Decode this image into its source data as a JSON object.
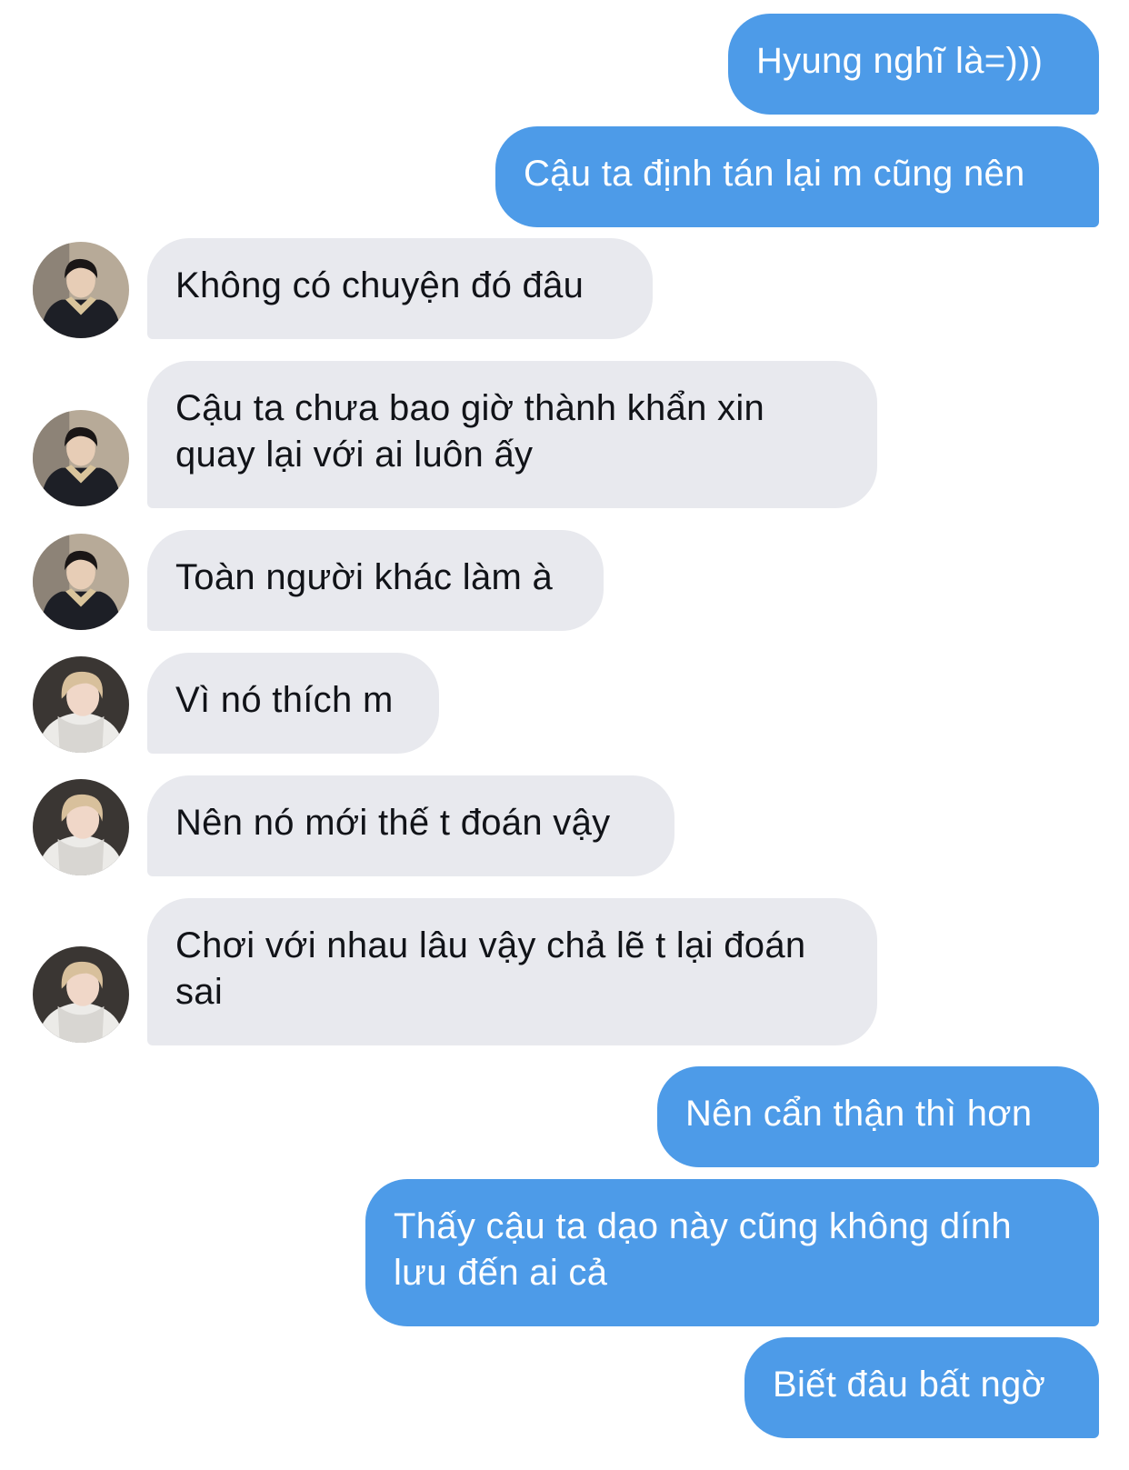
{
  "messages": [
    {
      "side": "out",
      "text": "Hyung nghĩ là=)))"
    },
    {
      "side": "out",
      "text": "Cậu ta định tán lại m cũng nên"
    },
    {
      "side": "in",
      "avatar": "avatar-dark-jacket-icon",
      "text": "Không có chuyện đó đâu"
    },
    {
      "side": "in",
      "avatar": "avatar-dark-jacket-icon",
      "text": "Cậu ta chưa bao giờ thành khẩn xin\nquay lại với ai luôn ấy"
    },
    {
      "side": "in",
      "avatar": "avatar-dark-jacket-icon",
      "text": "Toàn người khác làm à"
    },
    {
      "side": "in",
      "avatar": "avatar-blond-hoodie-icon",
      "text": "Vì nó thích m"
    },
    {
      "side": "in",
      "avatar": "avatar-blond-hoodie-icon",
      "text": "Nên nó mới thế t đoán vậy"
    },
    {
      "side": "in",
      "avatar": "avatar-blond-hoodie-icon",
      "text": "Chơi với nhau lâu vậy chả lẽ t lại đoán\nsai"
    },
    {
      "side": "out",
      "text": "Nên cẩn thận thì hơn"
    },
    {
      "side": "out",
      "text": "Thấy cậu ta dạo này cũng không dính\nlưu đến ai cả"
    },
    {
      "side": "out",
      "text": "Biết đâu bất ngờ"
    }
  ],
  "colors": {
    "outgoing_bubble": "#4d9be8",
    "incoming_bubble": "#e8e9ee",
    "outgoing_text": "#ffffff",
    "incoming_text": "#111318"
  }
}
